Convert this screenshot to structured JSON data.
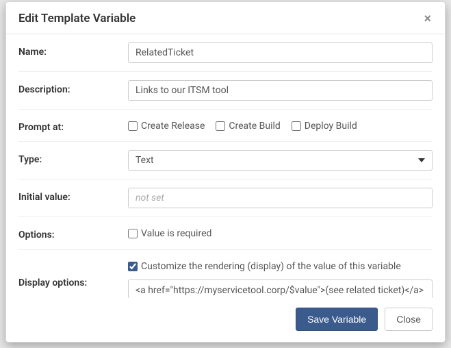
{
  "modal": {
    "title": "Edit Template Variable",
    "fields": {
      "name": {
        "label": "Name:",
        "value": "RelatedTicket"
      },
      "description": {
        "label": "Description:",
        "value": "Links to our ITSM tool"
      },
      "prompt_at": {
        "label": "Prompt at:",
        "options": [
          {
            "label": "Create Release",
            "checked": false
          },
          {
            "label": "Create Build",
            "checked": false
          },
          {
            "label": "Deploy Build",
            "checked": false
          }
        ]
      },
      "type": {
        "label": "Type:",
        "value": "Text"
      },
      "initial_value": {
        "label": "Initial value:",
        "placeholder": "not set",
        "value": ""
      },
      "options": {
        "label": "Options:",
        "required_label": "Value is required",
        "required_checked": false
      },
      "display_options": {
        "label": "Display options:",
        "customize_label": "Customize the rendering (display) of the value of this variable",
        "customize_checked": true,
        "template_value": "<a href=\"https://myservicetool.corp/$value\">(see related ticket)</a>"
      }
    },
    "footer": {
      "save": "Save Variable",
      "close": "Close"
    }
  }
}
